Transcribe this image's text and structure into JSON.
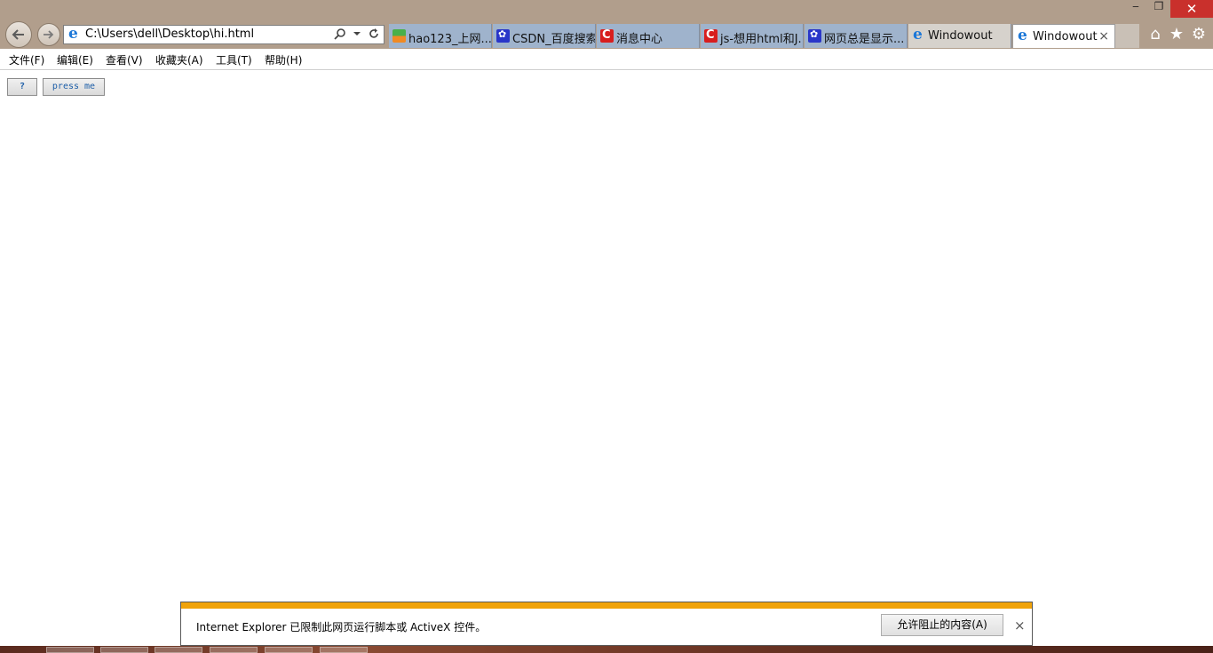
{
  "browser": {
    "address": "C:\\Users\\dell\\Desktop\\hi.html",
    "tabs": [
      {
        "label": "hao123_上网...",
        "icon": "hao123-icon",
        "active": false
      },
      {
        "label": "CSDN_百度搜索",
        "icon": "baidu-paw-icon",
        "active": false
      },
      {
        "label": "消息中心",
        "icon": "csdn-c-icon",
        "active": false
      },
      {
        "label": "js-想用html和J...",
        "icon": "csdn-c-icon",
        "active": false
      },
      {
        "label": "网页总是显示...",
        "icon": "baidu-paw-icon",
        "active": false
      },
      {
        "label": "Windowout",
        "icon": "ie-icon",
        "active": false
      },
      {
        "label": "Windowout",
        "icon": "ie-icon",
        "active": true
      }
    ],
    "tab_close_glyph": "×"
  },
  "window_controls": {
    "minimize": "‒",
    "maximize": "❐",
    "close": "✕"
  },
  "toolbar_icons": {
    "home": "⌂",
    "favorites": "★",
    "settings": "⚙"
  },
  "menu": {
    "file": "文件(F)",
    "edit": "编辑(E)",
    "view": "查看(V)",
    "favorites": "收藏夹(A)",
    "tools": "工具(T)",
    "help": "帮助(H)"
  },
  "page": {
    "help_button": "?",
    "press_button": "press me"
  },
  "notification": {
    "message": "Internet Explorer 已限制此网页运行脚本或 ActiveX 控件。",
    "allow_button": "允许阻止的内容(A)",
    "close": "×"
  },
  "colors": {
    "frame": "#b19e8c",
    "tab_inactive": "#9fb3cc",
    "notify_stripe": "#f0a30a",
    "close_button": "#c9302c"
  }
}
